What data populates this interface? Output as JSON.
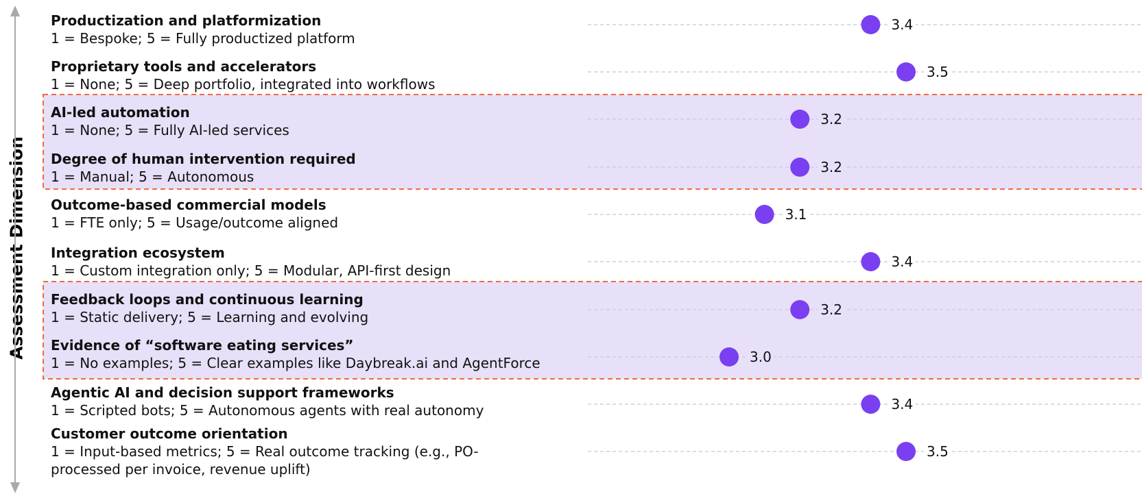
{
  "axis_label": "Assessment Dimension",
  "colors": {
    "dot": "#7a3ff0",
    "highlight_fill": "#e8e0f8",
    "highlight_border": "#f06a3a",
    "grid": "#d0d0d0",
    "axis_arrow": "#a9a9a9"
  },
  "chart_data": {
    "type": "scatter",
    "orientation": "horizontal-dot",
    "grid": true,
    "ylabel": "Assessment Dimension",
    "xlim": [
      1,
      5
    ],
    "dimensions": [
      {
        "title": "Productization and platformization",
        "scale": [
          "1 = Bespoke; 5 = Fully productized platform"
        ],
        "value": 3.4,
        "label": "3.4",
        "highlighted": false
      },
      {
        "title": "Proprietary tools and accelerators",
        "scale": [
          "1 = None; 5 = Deep portfolio, integrated into workflows"
        ],
        "value": 3.5,
        "label": "3.5",
        "highlighted": false
      },
      {
        "title": "AI-led automation",
        "scale": [
          "1 = None; 5 = Fully AI-led services"
        ],
        "value": 3.2,
        "label": "3.2",
        "highlighted": true
      },
      {
        "title": "Degree of human intervention required",
        "scale": [
          "1 = Manual; 5 = Autonomous"
        ],
        "value": 3.2,
        "label": "3.2",
        "highlighted": true
      },
      {
        "title": "Outcome-based commercial models",
        "scale": [
          "1 = FTE only; 5 = Usage/outcome aligned"
        ],
        "value": 3.1,
        "label": "3.1",
        "highlighted": false
      },
      {
        "title": "Integration ecosystem",
        "scale": [
          "1 = Custom integration only; 5 = Modular, API-first design"
        ],
        "value": 3.4,
        "label": "3.4",
        "highlighted": false
      },
      {
        "title": "Feedback loops and continuous learning",
        "scale": [
          "1 = Static delivery; 5 = Learning and evolving"
        ],
        "value": 3.2,
        "label": "3.2",
        "highlighted": true
      },
      {
        "title": "Evidence of “software eating services”",
        "scale": [
          "1 = No examples; 5 = Clear examples like Daybreak.ai and AgentForce"
        ],
        "value": 3.0,
        "label": "3.0",
        "highlighted": true
      },
      {
        "title": "Agentic AI and decision support frameworks",
        "scale": [
          "1 = Scripted bots; 5 = Autonomous agents with real autonomy"
        ],
        "value": 3.4,
        "label": "3.4",
        "highlighted": false
      },
      {
        "title": "Customer outcome orientation",
        "scale": [
          "1 = Input-based metrics; 5 = Real outcome tracking (e.g., PO-",
          "processed per invoice, revenue uplift)"
        ],
        "value": 3.5,
        "label": "3.5",
        "highlighted": false
      }
    ]
  }
}
